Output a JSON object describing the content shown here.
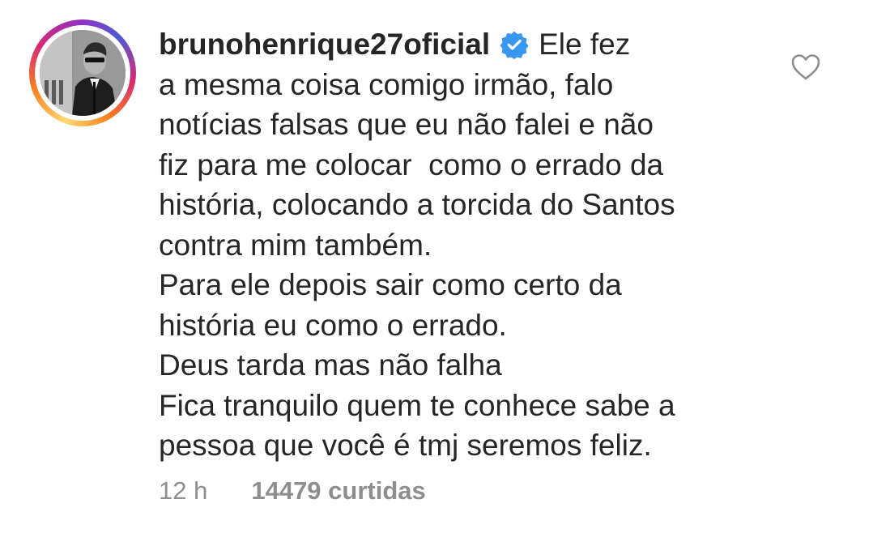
{
  "comment": {
    "username": "brunohenrique27oficial",
    "verified_icon": "verified-badge-icon",
    "text": "Ele fez\na mesma coisa comigo irmão, falo\nnotícias falsas que eu não falei e não\nfiz para me colocar  como o errado da\nhistória, colocando a torcida do Santos\ncontra mim também.\nPara ele depois sair como certo da\nhistória eu como o errado.\nDeus tarda mas não falha\nFica tranquilo quem te conhece sabe a\npessoa que você é tmj seremos feliz.",
    "time": "12 h",
    "likes": "14479 curtidas",
    "like_icon": "heart-outline-icon"
  },
  "colors": {
    "text": "#262626",
    "muted": "#8e8e8e",
    "verified": "#3897f0"
  }
}
